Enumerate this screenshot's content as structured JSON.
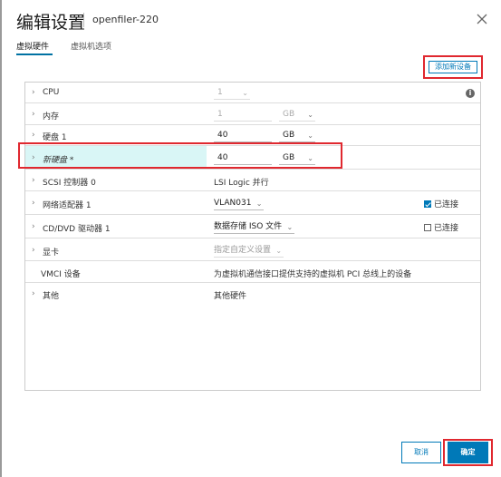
{
  "dialog": {
    "title": "编辑设置",
    "subtitle": "openfiler-220",
    "close_icon": "close-icon"
  },
  "tabs": [
    {
      "label": "虚拟硬件",
      "active": true
    },
    {
      "label": "虚拟机选项",
      "active": false
    }
  ],
  "toolbar": {
    "add_device_label": "添加新设备"
  },
  "hardware": {
    "cpu": {
      "label": "CPU",
      "value": "1"
    },
    "memory": {
      "label": "内存",
      "value": "1",
      "unit": "GB"
    },
    "disk1": {
      "label": "硬盘 1",
      "value": "40",
      "unit": "GB"
    },
    "new_disk": {
      "label": "新硬盘 *",
      "value": "40",
      "unit": "GB"
    },
    "scsi": {
      "label": "SCSI 控制器 0",
      "value": "LSI Logic 并行"
    },
    "nic": {
      "label": "网络适配器 1",
      "value": "VLAN031",
      "connected_label": "已连接",
      "connected": true
    },
    "cdrom": {
      "label": "CD/DVD 驱动器 1",
      "value": "数据存储 ISO 文件",
      "connected_label": "已连接",
      "connected": false
    },
    "video": {
      "label": "显卡",
      "value": "指定自定义设置"
    },
    "vmci": {
      "label": "VMCI 设备",
      "value": "为虚拟机通信接口提供支持的虚拟机 PCI 总线上的设备"
    },
    "other": {
      "label": "其他",
      "value": "其他硬件"
    }
  },
  "footer": {
    "cancel_label": "取消",
    "ok_label": "确定"
  },
  "colors": {
    "accent": "#0079b8",
    "highlight_border": "#e0282f",
    "row_highlight": "#d9f6f6"
  }
}
